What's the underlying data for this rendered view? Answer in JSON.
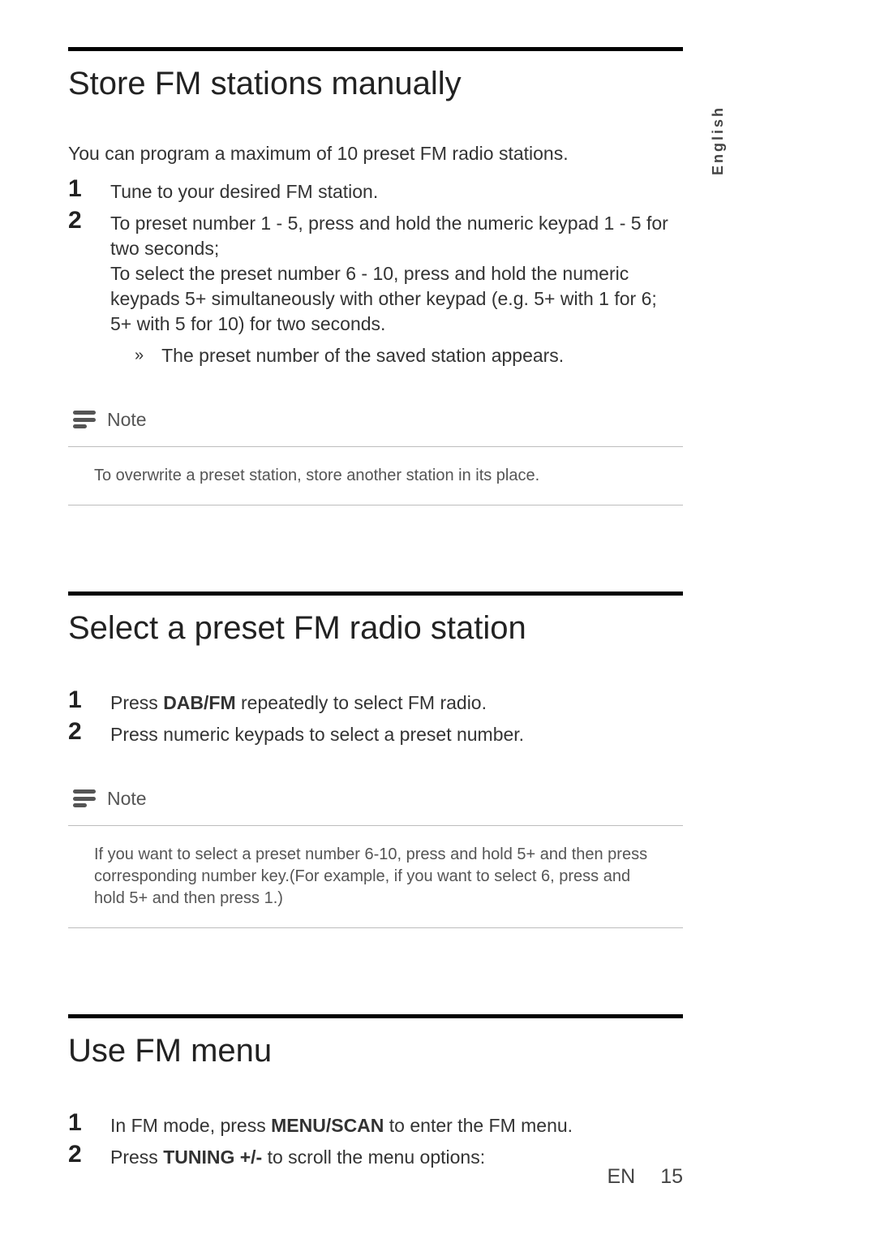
{
  "language_tab": "English",
  "sections": {
    "store": {
      "heading": "Store FM stations manually",
      "intro": "You can program a maximum of 10 preset FM radio stations.",
      "steps": {
        "s1": {
          "num": "1",
          "text": "Tune to your desired FM station."
        },
        "s2": {
          "num": "2",
          "line1": "To preset number 1 - 5, press and hold the numeric keypad 1 - 5 for two seconds;",
          "line2": "To select the preset number 6 - 10, press and hold the numeric keypads 5+ simultaneously with other keypad (e.g. 5+ with 1 for 6; 5+ with 5 for 10) for two seconds."
        }
      },
      "result_arrow": "»",
      "result": "The preset number of the saved station appears.",
      "note_label": "Note",
      "note_text": "To overwrite a preset station, store another station in its place."
    },
    "select": {
      "heading": "Select a preset FM radio station",
      "steps": {
        "s1": {
          "num": "1",
          "prefix": "Press ",
          "bold": "DAB/FM",
          "suffix": " repeatedly to select FM radio."
        },
        "s2": {
          "num": "2",
          "text": "Press numeric keypads to select a preset number."
        }
      },
      "note_label": "Note",
      "note_text": "If you want to select a preset number 6-10, press and hold 5+ and then press corresponding number key.(For example, if you want to select 6, press and hold 5+ and then press 1.)"
    },
    "usefm": {
      "heading": "Use FM menu",
      "steps": {
        "s1": {
          "num": "1",
          "prefix": "In FM mode, press ",
          "bold": "MENU/SCAN",
          "suffix": " to enter the FM menu."
        },
        "s2": {
          "num": "2",
          "prefix": "Press ",
          "bold": "TUNING +/-",
          "suffix": " to scroll the menu options:"
        }
      }
    }
  },
  "footer": {
    "lang": "EN",
    "page": "15"
  }
}
